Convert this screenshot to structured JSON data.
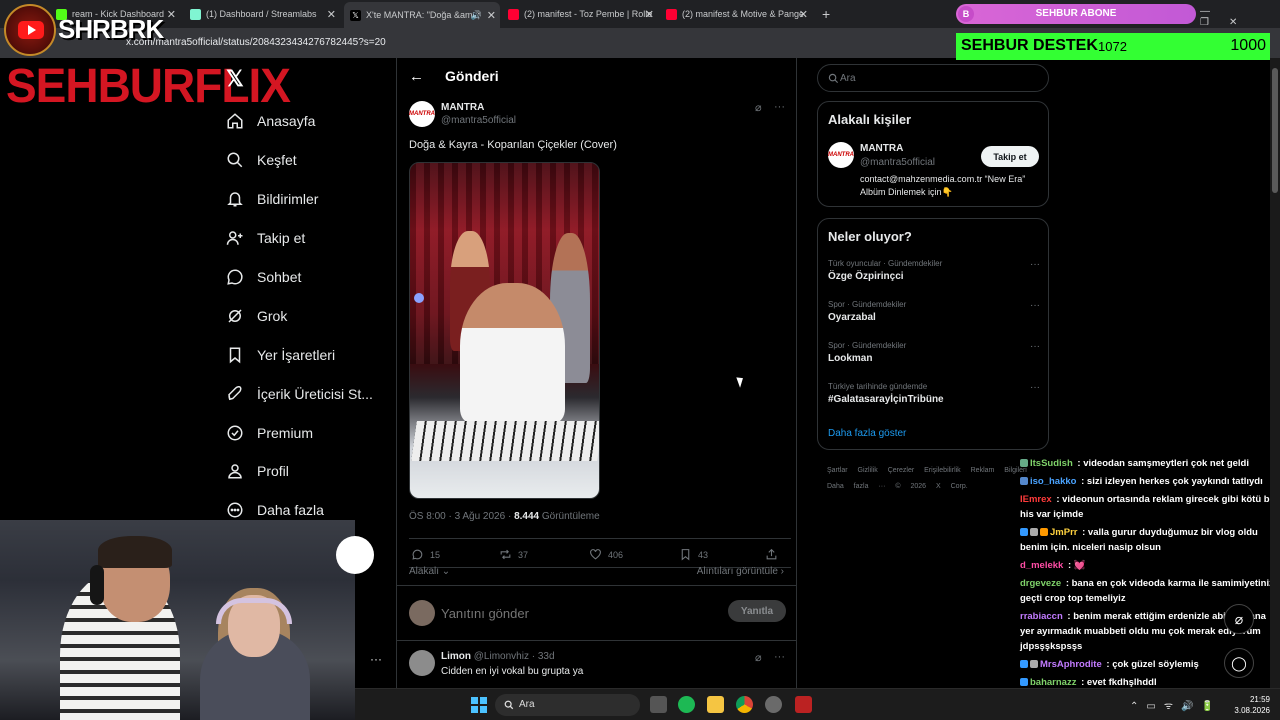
{
  "browser": {
    "tabs": [
      {
        "label": "ream - Kick Dashboard",
        "color": "#53fc18"
      },
      {
        "label": "(1) Dashboard / Streamlabs",
        "color": "#80f5d2"
      },
      {
        "label": "X'te MANTRA: \"Doğa &amp;",
        "color": "#ffffff"
      },
      {
        "label": "(2) manifest - Toz Pembe | Rolle",
        "color": "#ff0033"
      },
      {
        "label": "(2) manifest & Motive & Pange",
        "color": "#ff0033"
      }
    ],
    "new_tab": "+",
    "url": "x.com/mantra5official/status/2084323434276782445?s=20"
  },
  "overlay": {
    "shrbrk": "SHRBRK",
    "sehburflix": "SEHBURFLIX",
    "abone_badge": "B",
    "abone_label": "SEHBUR ABONE",
    "destek_title": "SEHBUR DESTEK",
    "destek_amount": "1072",
    "destek_goal": "1000"
  },
  "nav": {
    "logo": "𝕏",
    "items": [
      {
        "label": "Anasayfa",
        "icon": "home-icon"
      },
      {
        "label": "Keşfet",
        "icon": "search-icon"
      },
      {
        "label": "Bildirimler",
        "icon": "bell-icon"
      },
      {
        "label": "Takip et",
        "icon": "add-person-icon"
      },
      {
        "label": "Sohbet",
        "icon": "chat-icon"
      },
      {
        "label": "Grok",
        "icon": "grok-icon"
      },
      {
        "label": "Yer İşaretleri",
        "icon": "bookmark-icon"
      },
      {
        "label": "İçerik Üreticisi St...",
        "icon": "rocket-icon"
      },
      {
        "label": "Premium",
        "icon": "verified-icon"
      },
      {
        "label": "Profil",
        "icon": "person-icon"
      },
      {
        "label": "Daha fazla",
        "icon": "more-circle-icon"
      }
    ]
  },
  "post": {
    "header_back": "←",
    "header_title": "Gönderi",
    "avatar_text": "MANTRA",
    "name": "MANTRA",
    "handle": "@mantra5official",
    "text": "Doğa & Kayra - Koparılan Çiçekler (Cover)",
    "time": "ÖS 8:00 · 3 Ağu 2026 · ",
    "views": "8.444",
    "views_label": " Görüntüleme",
    "replies": "15",
    "reposts": "37",
    "likes": "406",
    "bookmarks": "43",
    "relevant": "Alakalı",
    "quotes": "Alıntıları görüntüle",
    "reply_placeholder": "Yanıtını gönder",
    "reply_button": "Yanıtla"
  },
  "comment": {
    "name": "Limon",
    "meta": " @Limonvhiz · 33d",
    "text": "Cidden en iyi vokal bu grupta ya"
  },
  "right": {
    "search_placeholder": "Ara",
    "related_title": "Alakalı kişiler",
    "related_name": "MANTRA",
    "related_handle": "@mantra5official",
    "follow_label": "Takip et",
    "related_bio": "contact@mahzenmedia.com.tr “New Era” Albüm Dinlemek için👇",
    "trends_title": "Neler oluyor?",
    "trends": [
      {
        "category": "Türk oyuncular · Gündemdekiler",
        "name": "Özge Özpirinçci"
      },
      {
        "category": "Spor · Gündemdekiler",
        "name": "Oyarzabal"
      },
      {
        "category": "Spor · Gündemdekiler",
        "name": "Lookman"
      },
      {
        "category": "Türkiye tarihinde gündemde",
        "name": "#GalatasarayİçinTribüne"
      }
    ],
    "show_more": "Daha fazla göster",
    "footer": "Şartlar Gizlilik Çerezler Erişilebilirlik Reklam Bilgileri Daha fazla ··· © 2026 X Corp."
  },
  "chat": [
    {
      "user": "ItsSudish",
      "color": "#7fd26a",
      "text": " : videodan samşmeytleri çok net geldi"
    },
    {
      "user": "iso_hakko",
      "color": "#4aa3ff",
      "text": " : sizi izleyen herkes çok yaykındı tatlıydı"
    },
    {
      "user": "IEmrex",
      "color": "#ff3b3b",
      "text": " : videonun ortasında reklam girecek gibi kötü bir his var içimde"
    },
    {
      "user": "JmPrr",
      "color": "#ffd23f",
      "text": " : valla gurur duyduğumuz bir vlog oldu benim için. niceleri nasip olsun"
    },
    {
      "user": "d_melekk",
      "color": "#ff4da6",
      "text": " : 💓"
    },
    {
      "user": "drgeveze",
      "color": "#7fd26a",
      "text": " : bana en çok videoda karma ile samimiyetiniz geçti crop top temeliyiz"
    },
    {
      "user": "rrabiaccn",
      "color": "#c27bff",
      "text": " : benim merak ettiğim erdenizle abi biz sana yer ayırmadık muabbeti oldu mu çok merak ediyorum jdpsşşkspsşs"
    },
    {
      "user": "MrsAphrodite",
      "color": "#c27bff",
      "text": " : çok güzel söylemiş"
    },
    {
      "user": "baharnazz",
      "color": "#7fd26a",
      "text": " : evet fkdhşlhddl"
    }
  ],
  "taskbar": {
    "search_placeholder": "Ara",
    "time": "21:59",
    "date": "3.08.2026"
  }
}
